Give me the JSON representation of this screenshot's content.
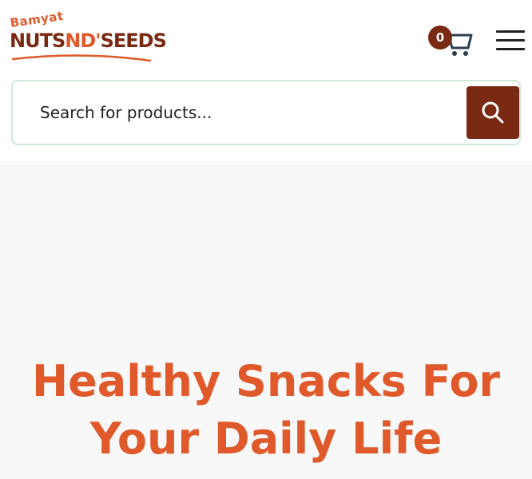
{
  "brand": {
    "tagline_top": "Bamyat",
    "name_part1": "NUTS",
    "name_part2": "ND",
    "name_part3": "SEEDS"
  },
  "header": {
    "cart_count": "0",
    "cart_icon": "cart-icon",
    "menu_icon": "hamburger-menu-icon"
  },
  "search": {
    "placeholder": "Search for products...",
    "button_icon": "search-icon"
  },
  "hero": {
    "title_line1": "Healthy Snacks For",
    "title_line2": "Your Daily Life"
  },
  "colors": {
    "brand_brown": "#7a2a12",
    "brand_orange": "#e0592a",
    "search_border": "#cfe8d8",
    "hero_bg": "#f8f8f8"
  }
}
